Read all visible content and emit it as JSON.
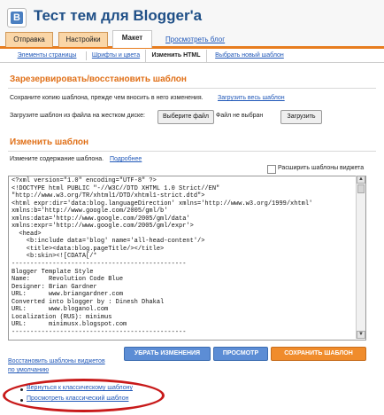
{
  "header": {
    "title": "Тест тем для Blogger'а",
    "logo_icon": "blogger-logo-icon",
    "logo_letter": "B"
  },
  "main_tabs": [
    {
      "label": "Отправка",
      "active": false
    },
    {
      "label": "Настройки",
      "active": false
    },
    {
      "label": "Макет",
      "active": true
    }
  ],
  "preview_blog_link": "Просмотреть блог",
  "sub_tabs": [
    {
      "label": "Элементы страницы",
      "active": false
    },
    {
      "label": "Шрифты и цвета",
      "active": false
    },
    {
      "label": "Изменить HTML",
      "active": true
    },
    {
      "label": "Выбрать новый шаблон",
      "active": false
    }
  ],
  "backup": {
    "title": "Зарезервировать/восстановить шаблон",
    "save_text": "Сохраните копию шаблона, прежде чем вносить в него изменения.",
    "download_link": "Загрузить весь шаблон",
    "upload_text": "Загрузите шаблон из файла на жестком диске:",
    "choose_file_button": "Выберите файл",
    "no_file_text": "Файл не выбран",
    "upload_button": "Загрузить"
  },
  "edit": {
    "title": "Изменить шаблон",
    "edit_text": "Измените содержание шаблона.",
    "more_link": "Подробнее",
    "expand_widgets_label": "Расширить шаблоны виджета",
    "expand_widgets_checked": false,
    "code_lines": [
      "<?xml version=\"1.0\" encoding=\"UTF-8\" ?>",
      "<!DOCTYPE html PUBLIC \"-//W3C//DTD XHTML 1.0 Strict//EN\"",
      "\"http://www.w3.org/TR/xhtml1/DTD/xhtml1-strict.dtd\">",
      "<html expr:dir='data:blog.languageDirection' xmlns='http://www.w3.org/1999/xhtml'",
      "xmlns:b='http://www.google.com/2005/gml/b'",
      "xmlns:data='http://www.google.com/2005/gml/data'",
      "xmlns:expr='http://www.google.com/2005/gml/expr'>",
      "  <head>",
      "    <b:include data='blog' name='all-head-content'/>",
      "    <title><data:blog.pageTitle/></title>",
      "    <b:skin><![CDATA[/*",
      "-----------------------------------------------",
      "Blogger Template Style",
      "Name:     Revolution Code Blue",
      "Designer: Brian Gardner",
      "URL:      www.briangardner.com",
      "Converted into blogger by : Dinesh Dhakal",
      "URL:      www.bloganol.com",
      "Localization (RUS): minimus",
      "URL:      minimusx.blogspot.com",
      "-----------------------------------------------"
    ]
  },
  "buttons": {
    "clear": "УБРАТЬ ИЗМЕНЕНИЯ",
    "preview": "ПРОСМОТР",
    "save": "СОХРАНИТЬ ШАБЛОН"
  },
  "restore_widgets_link_line1": "Восстановить шаблоны виджетов",
  "restore_widgets_link_line2": "по умолчанию",
  "classic_links": [
    "Вернуться к классическому шаблону",
    "Просмотреть классический шаблон"
  ],
  "colors": {
    "accent_orange": "#e07018",
    "tab_orange": "#fad6a7",
    "title_blue": "#1f4f87",
    "link_blue": "#1f57b8",
    "button_blue": "#5c8dd5",
    "highlight_red": "#c81a1a"
  }
}
